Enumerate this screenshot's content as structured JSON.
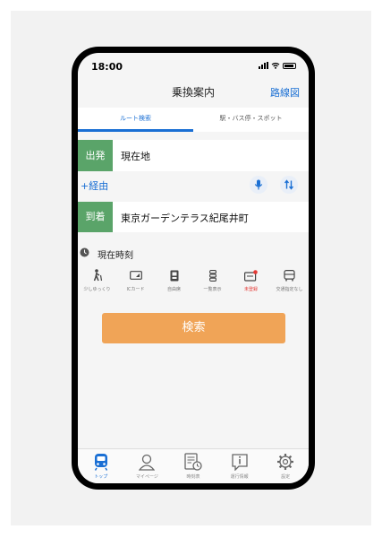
{
  "status": {
    "time": "18:00"
  },
  "nav": {
    "title": "乗換案内",
    "route_map": "路線図"
  },
  "tabs": [
    {
      "label": "ルート検索",
      "active": true
    },
    {
      "label": "駅・バス停・スポット",
      "active": false
    }
  ],
  "departure": {
    "tag": "出発",
    "value": "現在地"
  },
  "via": {
    "label": "+経由"
  },
  "arrival": {
    "tag": "到着",
    "value": "東京ガーデンテラス紀尾井町"
  },
  "time": {
    "label": "現在時刻"
  },
  "options": [
    {
      "label": "少しゆっくり",
      "icon": "walker-icon"
    },
    {
      "label": "ICカード",
      "icon": "ic-card-icon"
    },
    {
      "label": "自由席",
      "icon": "seat-icon"
    },
    {
      "label": "一覧表示",
      "icon": "list-icon"
    },
    {
      "label": "未登録",
      "icon": "commuter-pass-icon",
      "color": "#e53935"
    },
    {
      "label": "交通指定なし",
      "icon": "bus-icon"
    }
  ],
  "search": {
    "label": "検索"
  },
  "tabbar": [
    {
      "label": "トップ",
      "icon": "train-icon",
      "active": true
    },
    {
      "label": "マイページ",
      "icon": "user-icon"
    },
    {
      "label": "時刻表",
      "icon": "timetable-icon"
    },
    {
      "label": "運行情報",
      "icon": "info-icon"
    },
    {
      "label": "設定",
      "icon": "gear-icon"
    }
  ],
  "colors": {
    "accent": "#1a6fd4",
    "tag_green": "#5aa469",
    "search_orange": "#f0a457"
  }
}
